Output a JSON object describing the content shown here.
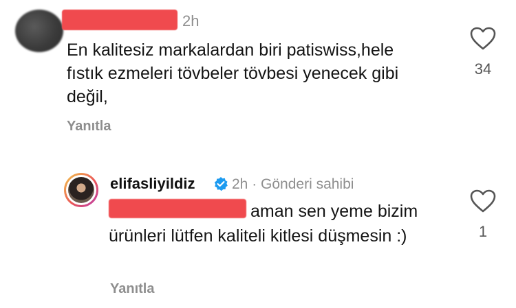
{
  "comment": {
    "time": "2h",
    "text": "En kalitesiz markalardan biri patiswiss,hele fıstık ezmeleri tövbeler tövbesi yenecek gibi değil,",
    "reply_label": "Yanıtla",
    "likes": "34",
    "heart_icon": "heart-outline-icon"
  },
  "reply": {
    "username": "elifasliyildiz",
    "verified_icon": "verified-badge-icon",
    "meta": "2h · Gönderi sahibi",
    "text": "aman sen yeme bizim ürünleri lütfen kaliteli kitlesi düşmesin :)",
    "reply_label": "Yanıtla",
    "likes": "1",
    "heart_icon": "heart-outline-icon",
    "accent_color": "#1d9bf0",
    "redaction_color": "#f04a4e"
  }
}
